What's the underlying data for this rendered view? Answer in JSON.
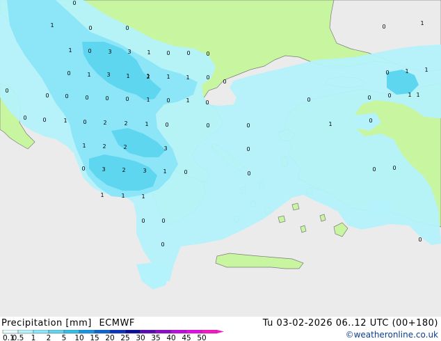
{
  "legend": {
    "title": "Precipitation [mm]",
    "model": "ECMWF",
    "scale_ticks": [
      "0.1",
      "0.5",
      "1",
      "2",
      "5",
      "10",
      "15",
      "20",
      "25",
      "30",
      "35",
      "40",
      "45",
      "50"
    ],
    "scale_colors": [
      "#e6fcff",
      "#b4f2fc",
      "#8ce6f8",
      "#5fd6f0",
      "#32bee6",
      "#1496e6",
      "#0a64d2",
      "#0a32be",
      "#0a0a9b",
      "#5a0ab4",
      "#8c0ac8",
      "#be0adc",
      "#e60ae6",
      "#fa14c8"
    ]
  },
  "timestamp": "Tu 03-02-2026 06..12 UTC (00+180)",
  "credit": "©weatheronline.co.uk",
  "colors": {
    "sea": "#ebebeb",
    "land": "#c8f5a0",
    "coast": "#7a7a7a",
    "light_precip": "#b4f2fc",
    "medium_precip": "#8ce6f8",
    "heavy_precip": "#5fd6f0"
  },
  "map_labels": [
    {
      "text": "0"
    },
    {
      "text": "1"
    },
    {
      "text": "0"
    },
    {
      "text": "0"
    },
    {
      "text": "0"
    },
    {
      "text": "1"
    },
    {
      "text": "1"
    },
    {
      "text": "0"
    },
    {
      "text": "3"
    },
    {
      "text": "3"
    },
    {
      "text": "1"
    },
    {
      "text": "0"
    },
    {
      "text": "0"
    },
    {
      "text": "0"
    },
    {
      "text": "0"
    },
    {
      "text": "1"
    },
    {
      "text": "3"
    },
    {
      "text": "1"
    },
    {
      "text": "2"
    },
    {
      "text": "1"
    },
    {
      "text": "1"
    },
    {
      "text": "0"
    },
    {
      "text": "0"
    },
    {
      "text": "0"
    },
    {
      "text": "0"
    },
    {
      "text": "0"
    },
    {
      "text": "0"
    },
    {
      "text": "0"
    },
    {
      "text": "1"
    },
    {
      "text": "0"
    },
    {
      "text": "1"
    },
    {
      "text": "0"
    },
    {
      "text": "1"
    },
    {
      "text": "0"
    },
    {
      "text": "0"
    },
    {
      "text": "1"
    },
    {
      "text": "0"
    },
    {
      "text": "2"
    },
    {
      "text": "2"
    },
    {
      "text": "1"
    },
    {
      "text": "0"
    },
    {
      "text": "0"
    },
    {
      "text": "0"
    },
    {
      "text": "0"
    },
    {
      "text": "1"
    },
    {
      "text": "1"
    },
    {
      "text": "2"
    },
    {
      "text": "2"
    },
    {
      "text": "3"
    },
    {
      "text": "0"
    },
    {
      "text": "0"
    },
    {
      "text": "3"
    },
    {
      "text": "2"
    },
    {
      "text": "3"
    },
    {
      "text": "1"
    },
    {
      "text": "0"
    },
    {
      "text": "0"
    },
    {
      "text": "0"
    },
    {
      "text": "0"
    },
    {
      "text": "1"
    },
    {
      "text": "1"
    },
    {
      "text": "1"
    },
    {
      "text": "0"
    },
    {
      "text": "0"
    },
    {
      "text": "0"
    },
    {
      "text": "1"
    },
    {
      "text": "1"
    },
    {
      "text": "0"
    },
    {
      "text": "1"
    },
    {
      "text": "0"
    },
    {
      "text": "0"
    },
    {
      "text": "0"
    },
    {
      "text": "0"
    },
    {
      "text": "1"
    },
    {
      "text": "0"
    }
  ]
}
